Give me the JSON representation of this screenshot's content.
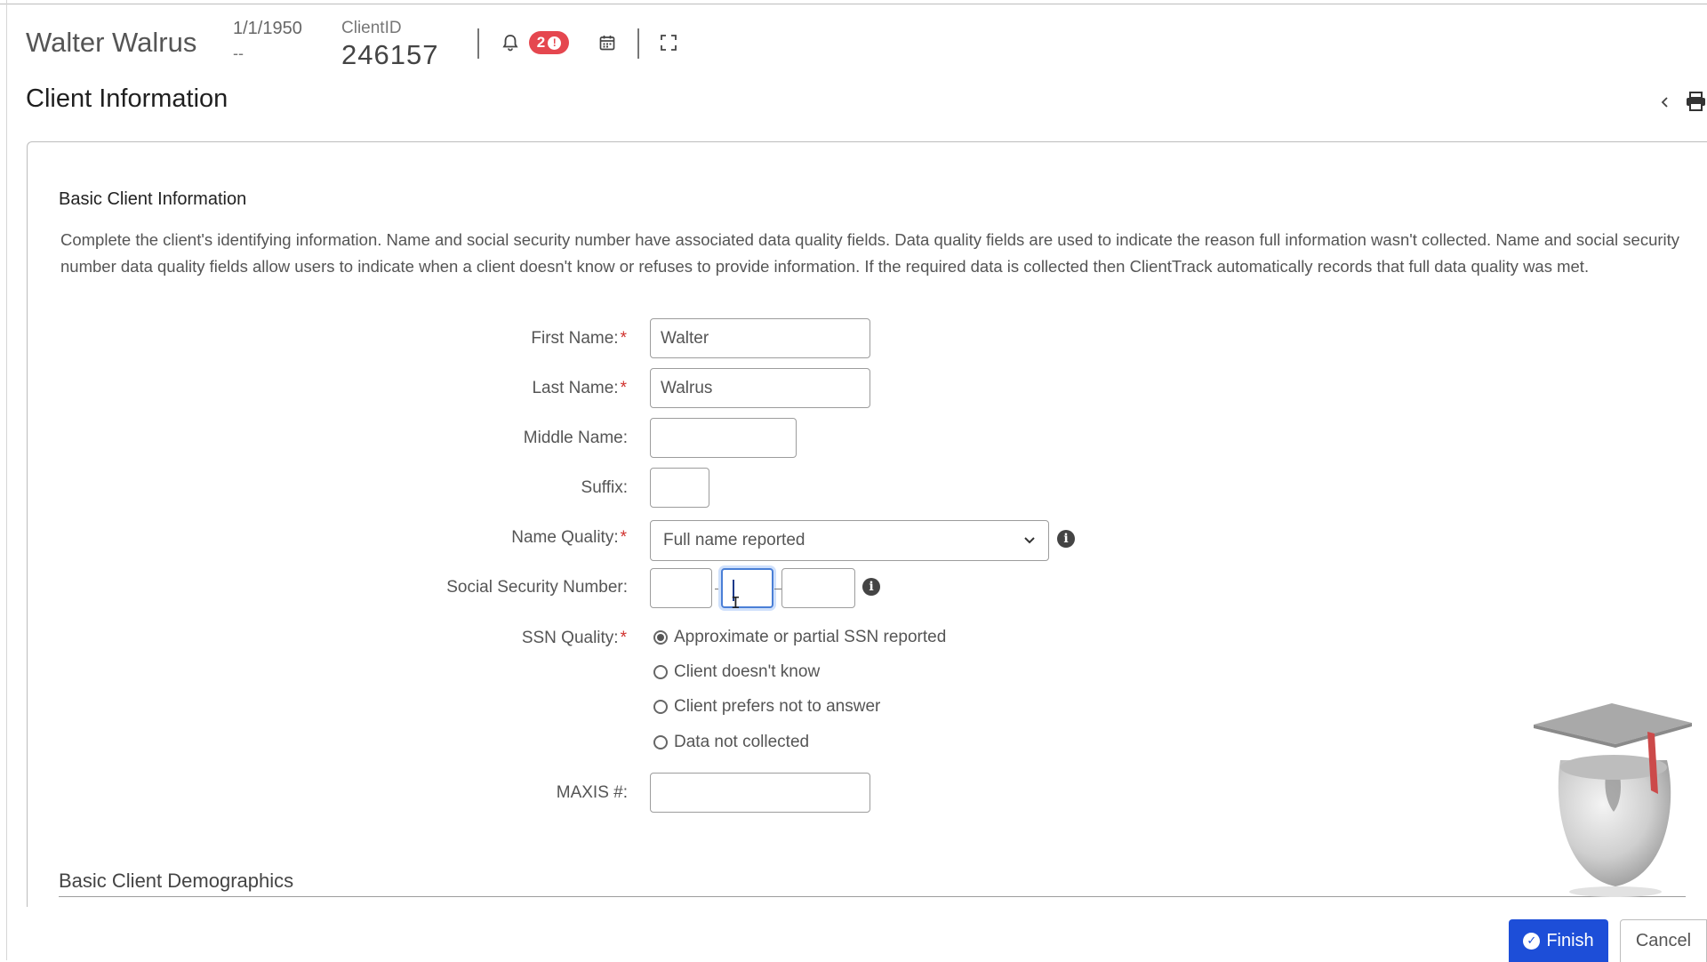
{
  "header": {
    "client_name": "Walter Walrus",
    "dob": "1/1/1950",
    "dob_sub": "--",
    "client_id_label": "ClientID",
    "client_id_value": "246157",
    "alert_count": "2",
    "alert_mark": "!",
    "icons": [
      "bell-icon",
      "calendar-icon",
      "fullscreen-icon",
      "chevron-left-icon",
      "print-icon"
    ]
  },
  "page": {
    "title": "Client Information"
  },
  "section": {
    "title": "Basic Client Information",
    "intro": "Complete the client's identifying information. Name and social security number have associated data quality fields. Data quality fields are used to indicate the reason full information wasn't collected. Name and social security number data quality fields allow users to indicate when a client doesn't know or refuses to provide information. If the required data is collected then ClientTrack automatically records that full data quality was met."
  },
  "form": {
    "first_name_label": "First Name:",
    "first_name_value": "Walter",
    "last_name_label": "Last Name:",
    "last_name_value": "Walrus",
    "middle_name_label": "Middle Name:",
    "middle_name_value": "",
    "suffix_label": "Suffix:",
    "suffix_value": "",
    "name_quality_label": "Name Quality:",
    "name_quality_value": "Full name reported",
    "ssn_label": "Social Security Number:",
    "ssn_part1": "",
    "ssn_part2": "",
    "ssn_part3": "",
    "ssn_quality_label": "SSN Quality:",
    "ssn_quality_options": [
      "Approximate or partial SSN reported",
      "Client doesn't know",
      "Client prefers not to answer",
      "Data not collected"
    ],
    "ssn_quality_selected": 0,
    "maxis_label": "MAXIS #:",
    "maxis_value": "",
    "required_mark": "*"
  },
  "demographics": {
    "title": "Basic Client Demographics"
  },
  "footer": {
    "finish_label": "Finish",
    "cancel_label": "Cancel"
  },
  "colors": {
    "badge": "#e5474f",
    "primary": "#1d4ed8",
    "required": "#d0312d",
    "focus": "#4a7fd6"
  }
}
